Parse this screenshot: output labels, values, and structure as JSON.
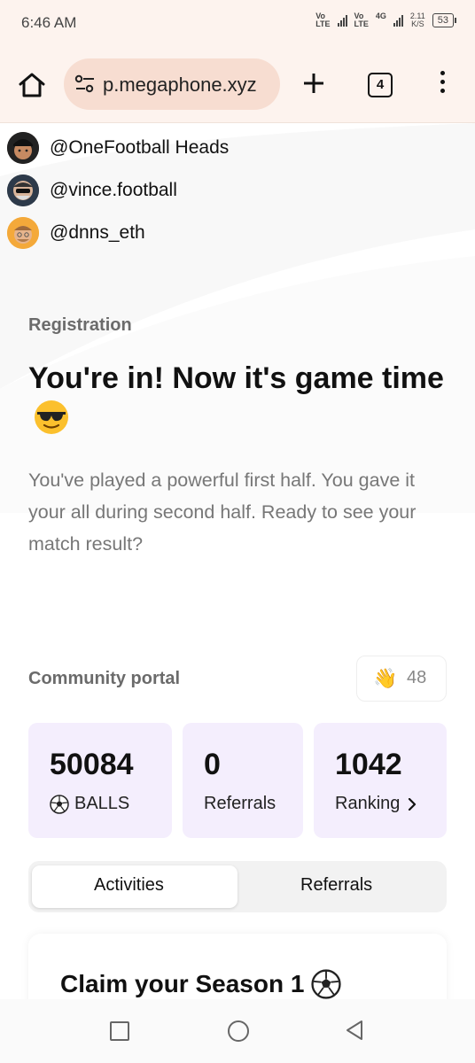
{
  "status_bar": {
    "time": "6:46 AM",
    "sim1": {
      "top": "Vo",
      "bottom": "LTE"
    },
    "sim2": {
      "top": "Vo",
      "bottom": "LTE"
    },
    "network": "4G",
    "speed_value": "2.11",
    "speed_unit": "K/S",
    "battery": "53"
  },
  "browser": {
    "url": "p.megaphone.xyz",
    "tab_count": "4",
    "icons": [
      "home-icon",
      "site-settings-icon",
      "plus-icon",
      "tabs-icon",
      "more-vert-icon"
    ]
  },
  "leaderboard_users": [
    {
      "handle": "@OneFootball Heads"
    },
    {
      "handle": "@vince.football"
    },
    {
      "handle": "@dnns_eth"
    }
  ],
  "registration": {
    "label": "Registration",
    "headline": "You're in! Now it's game time",
    "body": "You've played a powerful first half. You gave it your all during second half. Ready to see your match result?"
  },
  "community": {
    "label": "Community portal",
    "wave_emoji": "👋",
    "wave_count": "48"
  },
  "stats": [
    {
      "value": "50084",
      "label": "BALLS"
    },
    {
      "value": "0",
      "label": "Referrals"
    },
    {
      "value": "1042",
      "label": "Ranking"
    }
  ],
  "tabs": {
    "items": [
      "Activities",
      "Referrals"
    ],
    "active": "Activities"
  },
  "claim": {
    "title": "Claim your Season 1"
  },
  "colors": {
    "header_bg": "#fdf3ee",
    "url_pill_bg": "#f7ddd1",
    "stat_card_bg": "#f4eefd"
  }
}
